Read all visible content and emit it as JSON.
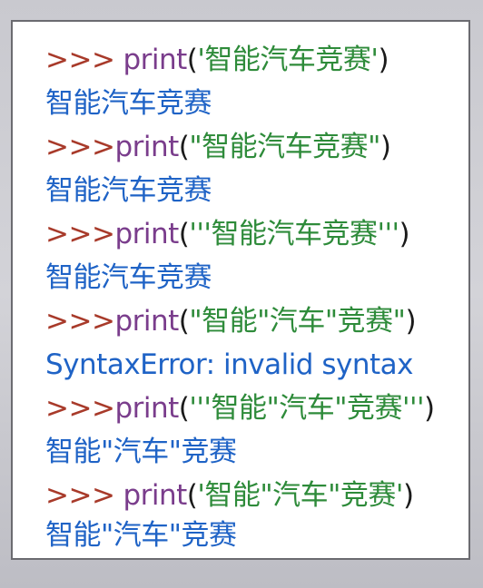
{
  "lines": [
    {
      "type": "input",
      "prompt": ">>>",
      "space": true,
      "func": "print",
      "open": "(",
      "literal": "'智能汽车竞赛'",
      "close": ")"
    },
    {
      "type": "output",
      "text": "智能汽车竞赛"
    },
    {
      "type": "input",
      "prompt": ">>>",
      "space": false,
      "func": "print",
      "open": "(",
      "literal": "\"智能汽车竞赛\"",
      "close": ")"
    },
    {
      "type": "output",
      "text": "智能汽车竞赛"
    },
    {
      "type": "input",
      "prompt": ">>>",
      "space": false,
      "func": "print",
      "open": "(",
      "literal": "'''智能汽车竞赛'''",
      "close": ")"
    },
    {
      "type": "output",
      "text": "智能汽车竞赛"
    },
    {
      "type": "input",
      "prompt": ">>>",
      "space": false,
      "func": "print",
      "open": "(",
      "literal": "\"智能\"汽车\"竞赛\"",
      "close": ")"
    },
    {
      "type": "output",
      "text": "SyntaxError: invalid syntax"
    },
    {
      "type": "input",
      "prompt": ">>>",
      "space": false,
      "func": "print",
      "open": "(",
      "literal": "'''智能\"汽车\"竞赛'''",
      "close": ")"
    },
    {
      "type": "output",
      "text": "智能\"汽车\"竞赛"
    },
    {
      "type": "input",
      "prompt": ">>>",
      "space": true,
      "func": "print",
      "open": "(",
      "literal": "'智能\"汽车\"竞赛'",
      "close": ")"
    },
    {
      "type": "output",
      "text": "智能\"汽车\"竞赛"
    }
  ],
  "colors": {
    "prompt": "#a83a2a",
    "keyword": "#7a3d8c",
    "string": "#2e8b3a",
    "output": "#1f63c6"
  }
}
